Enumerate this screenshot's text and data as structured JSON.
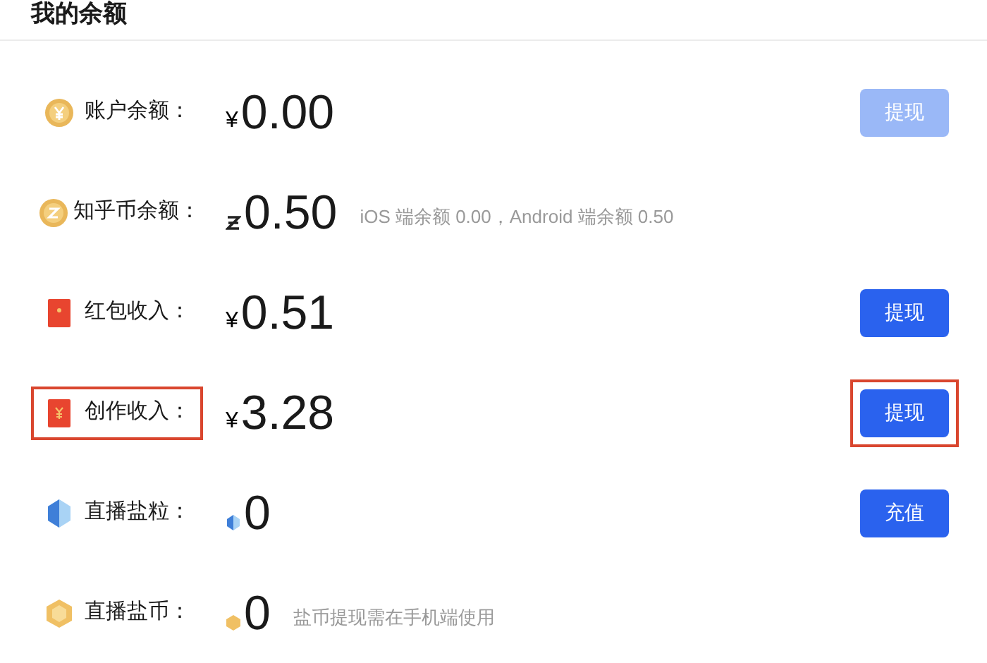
{
  "title": "我的余额",
  "rows": [
    {
      "kind": "coin-yen",
      "label": "账户余额：",
      "currency": {
        "kind": "yen",
        "symbol": "¥"
      },
      "amount": "0.00",
      "highlighted": false,
      "button": {
        "label": "提现",
        "disabled": true
      }
    },
    {
      "kind": "coin-zhihu",
      "label": "知乎币余额：",
      "currency": {
        "kind": "zhihu"
      },
      "amount": "0.50",
      "note": "iOS 端余额 0.00，Android 端余额 0.50",
      "highlighted": false
    },
    {
      "kind": "red-packet",
      "label": "红包收入：",
      "currency": {
        "kind": "yen",
        "symbol": "¥"
      },
      "amount": "0.51",
      "highlighted": false,
      "button": {
        "label": "提现",
        "disabled": false
      }
    },
    {
      "kind": "red-packet-yen",
      "label": "创作收入：",
      "currency": {
        "kind": "yen",
        "symbol": "¥"
      },
      "amount": "3.28",
      "highlighted": true,
      "button": {
        "label": "提现",
        "disabled": false
      }
    },
    {
      "kind": "salt-grain",
      "label": "直播盐粒：",
      "currency": {
        "kind": "grain"
      },
      "amount": "0",
      "highlighted": false,
      "button": {
        "label": "充值",
        "disabled": false
      }
    },
    {
      "kind": "salt-coin",
      "label": "直播盐币：",
      "currency": {
        "kind": "salt-coin"
      },
      "amount": "0",
      "note": "盐币提现需在手机端使用",
      "highlighted": false
    }
  ]
}
